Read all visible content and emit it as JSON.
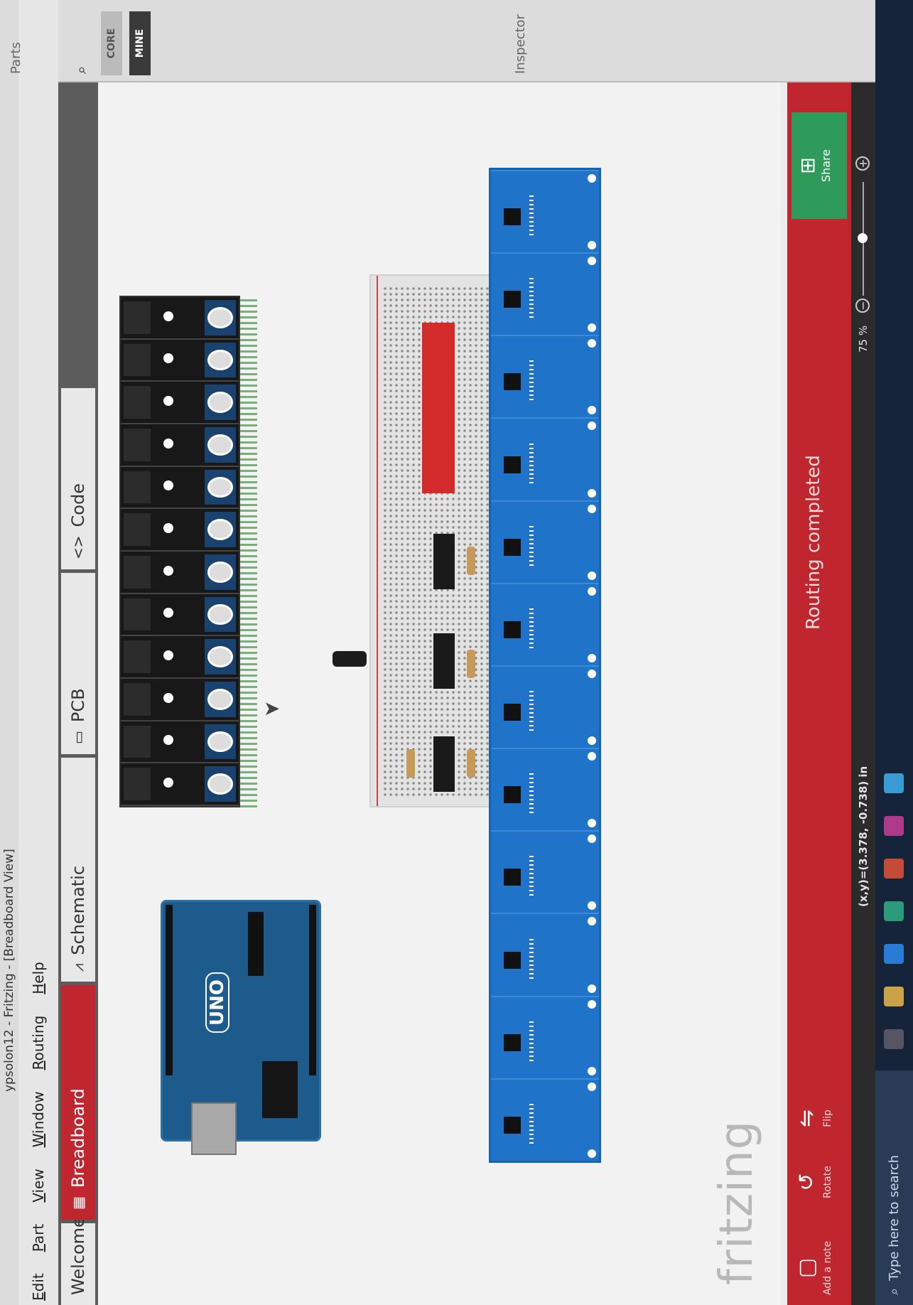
{
  "titlebar": {
    "text": "ypsolon12 - Fritzing - [Breadboard View]"
  },
  "menu": [
    "Edit",
    "Part",
    "View",
    "Window",
    "Routing",
    "Help"
  ],
  "tabs": {
    "welcome": "Welcome",
    "breadboard": "Breadboard",
    "schematic": "Schematic",
    "pcb": "PCB",
    "code": "Code"
  },
  "canvas": {
    "logo": "fritzing",
    "arduino_label": "UNO"
  },
  "toolbar": {
    "note": "Add a note",
    "rotate": "Rotate",
    "flip": "Flip",
    "status": "Routing completed",
    "share": "Share"
  },
  "statusbar": {
    "coords": "(x,y)=(3.378, -0.738) in",
    "zoom": "75 %"
  },
  "taskbar": {
    "search_placeholder": "Type here to search"
  },
  "right_panel": {
    "parts": "Parts",
    "core": "CORE",
    "mine": "MINE",
    "inspector": "Inspector"
  },
  "colors": {
    "accent": "#c0262e",
    "share": "#2f9b5a",
    "module_blue": "#1f74c9"
  }
}
